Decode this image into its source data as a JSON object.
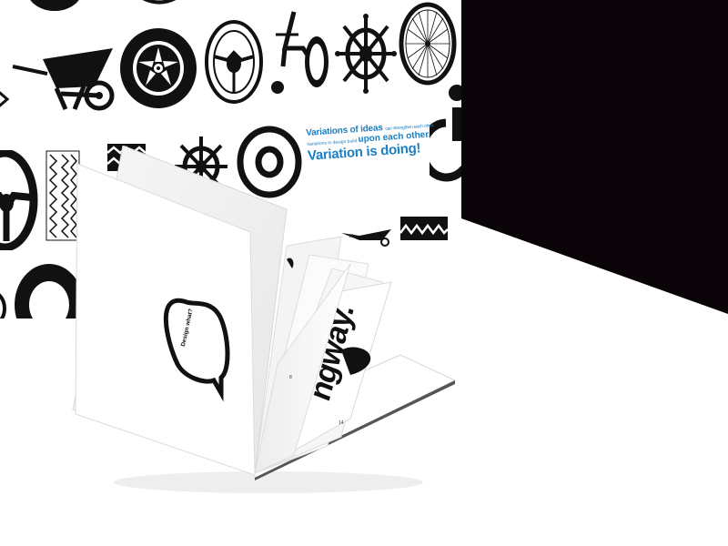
{
  "poster": {
    "line1_large": "Variations of ideas",
    "line1_small": "can strengthen each other.",
    "line2_small": "Variations in design build",
    "line2_large": "upon each other.",
    "line3": "Variation is doing!"
  },
  "booklet": {
    "bubble_text": "Design what?",
    "big_word": "ngway.",
    "page_numbers": [
      "18",
      "8",
      "14",
      "16"
    ]
  },
  "colors": {
    "accent": "#1b7fc1",
    "ink": "#111111",
    "dark_panel": "#0a0307",
    "paper": "#ffffff"
  },
  "icons": [
    "wheelbarrow-icon",
    "car-wheel-icon",
    "steering-wheel-icon",
    "wheelchair-icon",
    "ship-wheel-icon",
    "bicycle-wheel-icon",
    "tire-tread-icon",
    "target-ring-icon",
    "accessibility-icon"
  ]
}
